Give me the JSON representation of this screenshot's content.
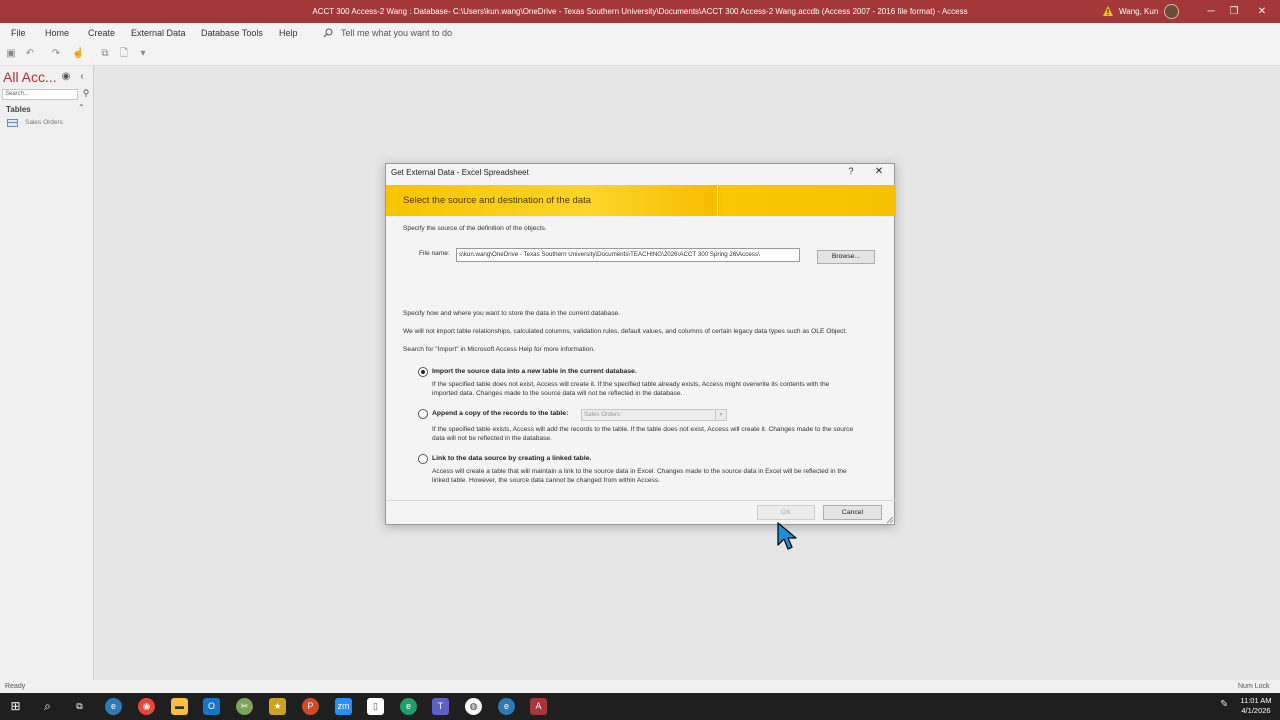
{
  "window": {
    "title": "ACCT 300 Access-2 Wang : Database- C:\\Users\\kun.wang\\OneDrive - Texas Southern University\\Documents\\ACCT 300 Access-2 Wang.accdb (Access 2007 - 2016 file format)  -  Access",
    "user": "Wang, Kun",
    "accent_color": "#a4373a"
  },
  "menu": {
    "items": [
      "File",
      "Home",
      "Create",
      "External Data",
      "Database Tools",
      "Help"
    ],
    "tell_me": "Tell me what you want to do"
  },
  "nav_pane": {
    "header": "All Acc...",
    "search_placeholder": "Search...",
    "group": "Tables",
    "items": [
      "Sales Orders"
    ]
  },
  "dialog": {
    "title": "Get External Data - Excel Spreadsheet",
    "help": "?",
    "close": "✕",
    "banner": "Select the source and destination of the data",
    "source_intro": "Specify the source of the definition of the objects.",
    "file_label": "File name:",
    "file_value": "s\\kun.wang\\OneDrive - Texas Southern University\\Documents\\TEACHING\\2026\\ACCT 300 Spring 26\\Access\\",
    "browse": "Browse...",
    "dest_intro": "Specify how and where you want to store the data in the current database.",
    "warning": "We will not import table relationships, calculated columns, validation rules, default values, and columns of certain legacy data types such as OLE Object.",
    "help_hint": "Search for \"Import\" in Microsoft Access Help for more information.",
    "options": [
      {
        "label": "Import the source data into a new table in the current database.",
        "desc1": "If the specified table does not exist, Access will create it. If the specified table already exists, Access might overwrite its contents with the",
        "desc2": "imported data. Changes made to the source data will not be reflected in the database.",
        "selected": true
      },
      {
        "label": "Append a copy of the records to the table:",
        "combo": "Sales Orders",
        "desc1": "If the specified table exists, Access will add the records to the table. If the table does not exist, Access will create it. Changes made to the source",
        "desc2": "data will not be reflected in the database.",
        "selected": false
      },
      {
        "label": "Link to the data source by creating a linked table.",
        "desc1": "Access will create a table that will maintain a link to the source data in Excel. Changes made to the source data in Excel will be reflected in the",
        "desc2": "linked table. However, the source data cannot be changed from within Access.",
        "selected": false
      }
    ],
    "ok": "OK",
    "cancel": "Cancel"
  },
  "status": {
    "left": "Ready",
    "right": "Num Lock"
  },
  "taskbar": {
    "time": "11:01 AM",
    "date": "4/1/2026"
  }
}
